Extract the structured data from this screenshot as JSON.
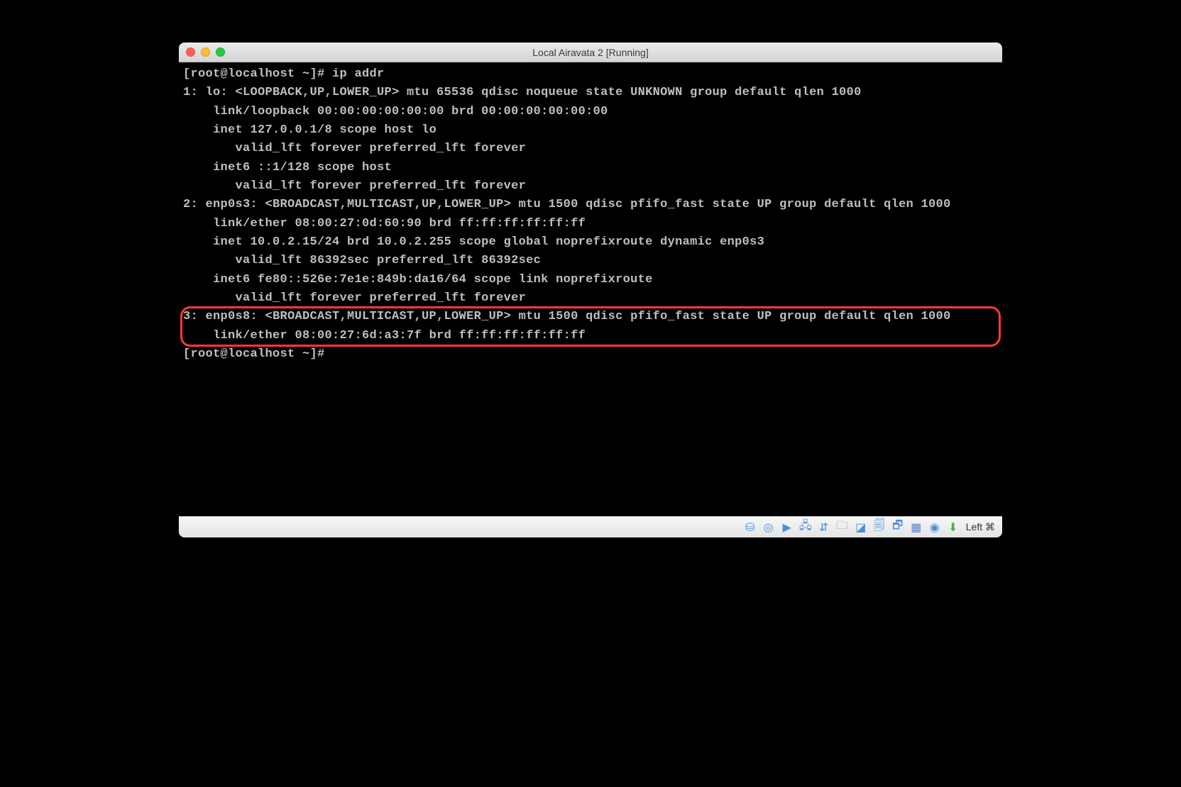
{
  "window": {
    "title": "Local Airavata 2 [Running]"
  },
  "terminal": {
    "prompt1": "[root@localhost ~]# ",
    "command1": "ip addr",
    "output": {
      "l1": "1: lo: <LOOPBACK,UP,LOWER_UP> mtu 65536 qdisc noqueue state UNKNOWN group default qlen 1000",
      "l2": "    link/loopback 00:00:00:00:00:00 brd 00:00:00:00:00:00",
      "l3": "    inet 127.0.0.1/8 scope host lo",
      "l4": "       valid_lft forever preferred_lft forever",
      "l5": "    inet6 ::1/128 scope host ",
      "l6": "       valid_lft forever preferred_lft forever",
      "l7": "2: enp0s3: <BROADCAST,MULTICAST,UP,LOWER_UP> mtu 1500 qdisc pfifo_fast state UP group default qlen 1000",
      "l8": "    link/ether 08:00:27:0d:60:90 brd ff:ff:ff:ff:ff:ff",
      "l9": "    inet 10.0.2.15/24 brd 10.0.2.255 scope global noprefixroute dynamic enp0s3",
      "l10": "       valid_lft 86392sec preferred_lft 86392sec",
      "l11": "    inet6 fe80::526e:7e1e:849b:da16/64 scope link noprefixroute ",
      "l12": "       valid_lft forever preferred_lft forever",
      "h1": "3: enp0s8: <BROADCAST,MULTICAST,UP,LOWER_UP> mtu 1500 qdisc pfifo_fast state UP group default qlen 1000",
      "h2": "    link/ether 08:00:27:6d:a3:7f brd ff:ff:ff:ff:ff:ff"
    },
    "prompt2": "[root@localhost ~]# "
  },
  "statusbar": {
    "host_key": "Left ⌘"
  },
  "icons": {
    "hdd": "⛁",
    "cd": "◎",
    "video": "▶",
    "net": "🖧",
    "usb": "⇵",
    "folder": "🗀",
    "display": "◪",
    "clipboard": "🗐",
    "drag": "🗗",
    "chip": "▦",
    "mouse": "◉",
    "down": "⬇"
  }
}
